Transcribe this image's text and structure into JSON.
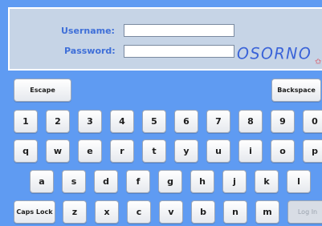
{
  "login": {
    "username_label": "Username:",
    "username_value": "",
    "password_label": "Password:",
    "password_value": ""
  },
  "brand": {
    "text": "OSORNO"
  },
  "keys": {
    "escape": "Escape",
    "backspace": "Backspace",
    "row_numbers": [
      "1",
      "2",
      "3",
      "4",
      "5",
      "6",
      "7",
      "8",
      "9",
      "0"
    ],
    "row_q": [
      "q",
      "w",
      "e",
      "r",
      "t",
      "y",
      "u",
      "i",
      "o",
      "p"
    ],
    "row_a": [
      "a",
      "s",
      "d",
      "f",
      "g",
      "h",
      "j",
      "k",
      "l"
    ],
    "caps_lock": "Caps Lock",
    "row_z": [
      "z",
      "x",
      "c",
      "v",
      "b",
      "n",
      "m"
    ],
    "login": "Log In"
  }
}
